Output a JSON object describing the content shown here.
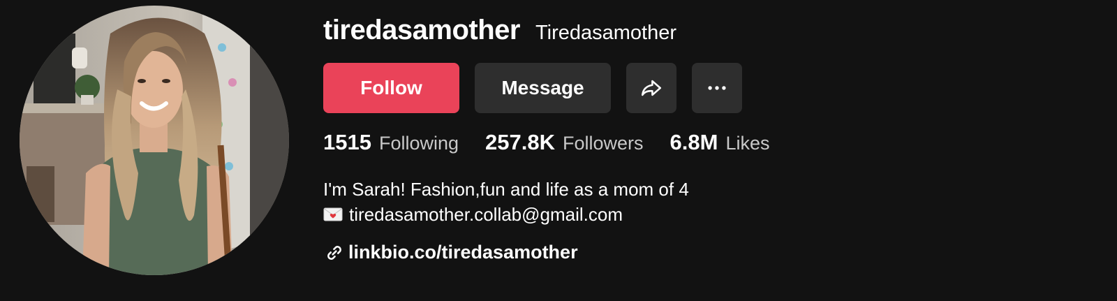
{
  "profile": {
    "username": "tiredasamother",
    "display_name": "Tiredasamother",
    "avatar_icon": "profile-photo"
  },
  "actions": {
    "follow_label": "Follow",
    "message_label": "Message",
    "share_icon": "share-arrow-icon",
    "more_icon": "more-dots-icon"
  },
  "stats": {
    "following_count": "1515",
    "following_label": "Following",
    "followers_count": "257.8K",
    "followers_label": "Followers",
    "likes_count": "6.8M",
    "likes_label": "Likes"
  },
  "bio": {
    "line1": "I'm Sarah! Fashion,fun and life as a mom of 4",
    "line2": "tiredasamother.collab@gmail.com",
    "line2_icon": "love-letter-emoji"
  },
  "link": {
    "text": "linkbio.co/tiredasamother",
    "icon": "link-icon"
  },
  "colors": {
    "background": "#121212",
    "follow_button": "#ea4359",
    "secondary_button": "#2e2e2e",
    "secondary_text": "#c9c9c9"
  }
}
